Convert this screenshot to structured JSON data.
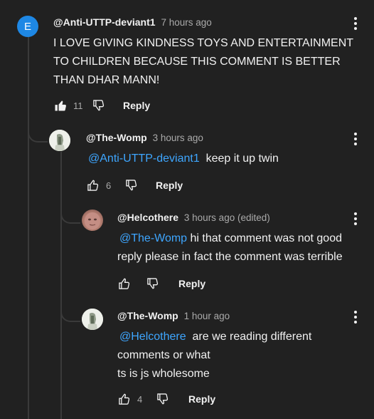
{
  "comments": [
    {
      "author": "@Anti-UTTP-deviant1",
      "time": "7 hours ago",
      "avatar_letter": "E",
      "text": "I LOVE GIVING KINDNESS TOYS AND ENTERTAINMENT TO CHILDREN BECAUSE THIS COMMENT IS BETTER THAN DHAR MANN!",
      "likes": "11",
      "reply_label": "Reply"
    },
    {
      "author": "@The-Womp",
      "time": "3 hours ago",
      "mention": "@Anti-UTTP-deviant1",
      "text": "keep it up twin",
      "likes": "6",
      "reply_label": "Reply"
    },
    {
      "author": "@Helcothere",
      "time": "3 hours ago (edited)",
      "mention": "@The-Womp",
      "text_line1": "hi that comment was not good",
      "text_line2": "reply please in fact the comment was terrible",
      "likes": "",
      "reply_label": "Reply"
    },
    {
      "author": "@The-Womp",
      "time": "1 hour ago",
      "mention": "@Helcothere",
      "text_line1": "are we reading different",
      "text_line2": "comments or what",
      "text_line3": "ts is js wholesome",
      "likes": "4",
      "reply_label": "Reply"
    }
  ],
  "colors": {
    "background": "#212121",
    "text": "#f1f1f1",
    "secondary": "#aaaaaa",
    "mention": "#3ea6ff",
    "avatar_letter_bg": "#1e88e5"
  },
  "icons": [
    "thumbs-up-icon",
    "thumbs-down-icon",
    "more-vert-icon"
  ]
}
